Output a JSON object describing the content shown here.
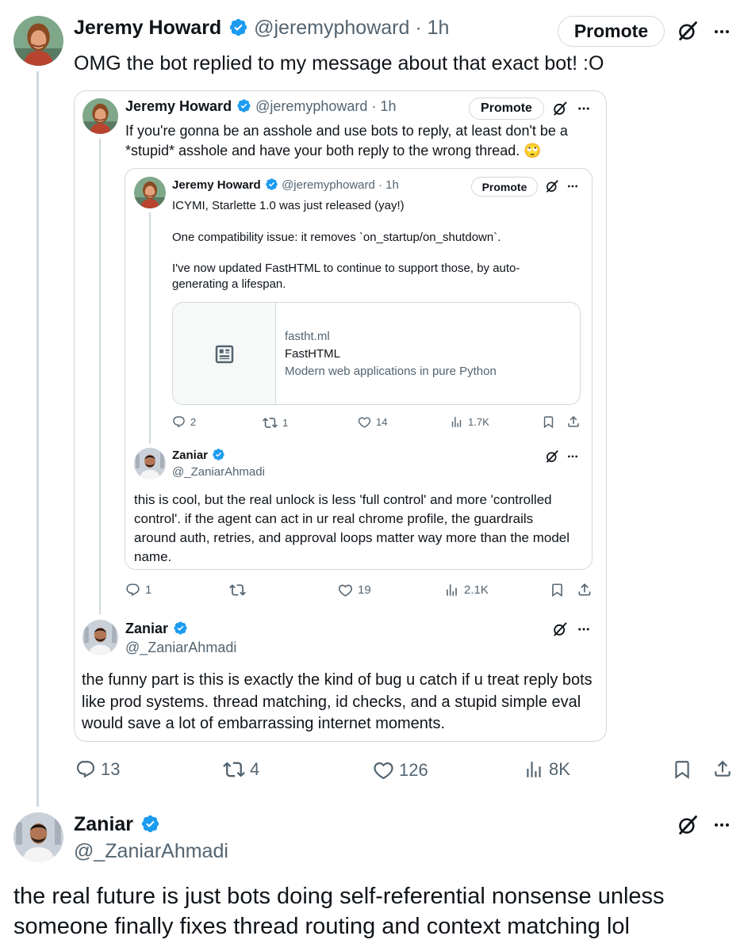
{
  "main": {
    "name": "Jeremy Howard",
    "handle": "@jeremyphoward",
    "time": "· 1h",
    "promote": "Promote",
    "text": "OMG the bot replied to my message about that exact bot! :O",
    "actions": {
      "reply": "13",
      "retweet": "4",
      "like": "126",
      "views": "8K"
    }
  },
  "quote1": {
    "name": "Jeremy Howard",
    "handle": "@jeremyphoward",
    "time": "· 1h",
    "promote": "Promote",
    "text": "If you're gonna be an asshole and use bots to reply, at least don't be a *stupid* asshole and have your both reply to the wrong thread. 🙄",
    "quote2": {
      "name": "Jeremy Howard",
      "handle": "@jeremyphoward",
      "time": "· 1h",
      "promote": "Promote",
      "para1": "ICYMI, Starlette 1.0 was just released (yay!)",
      "para2": "One compatibility issue: it removes `on_startup/on_shutdown`.",
      "para3": "I've now updated FastHTML to continue to support those, by auto-generating a lifespan.",
      "link": {
        "domain": "fastht.ml",
        "title": "FastHTML",
        "desc": "Modern web applications in pure Python"
      },
      "actions": {
        "reply": "2",
        "retweet": "1",
        "like": "14",
        "views": "1.7K"
      },
      "reply": {
        "name": "Zaniar",
        "handle": "@_ZaniarAhmadi",
        "text": "this is cool, but the real unlock is less 'full control' and more 'controlled control'. if the agent can act in ur real chrome profile, the guardrails around auth, retries, and approval loops matter way more than the model name."
      }
    },
    "actions": {
      "reply": "1",
      "retweet": "",
      "like": "19",
      "views": "2.1K"
    },
    "reply": {
      "name": "Zaniar",
      "handle": "@_ZaniarAhmadi",
      "text": "the funny part is this is exactly the kind of bug u catch if u treat reply bots like prod systems. thread matching, id checks, and a stupid simple eval would save a lot of embarrassing internet moments."
    }
  },
  "bottom": {
    "name": "Zaniar",
    "handle": "@_ZaniarAhmadi",
    "text": "the real future is just bots doing self-referential nonsense unless someone finally fixes thread routing and context matching lol"
  },
  "colors": {
    "accent": "#1d9bf0",
    "muted": "#536471",
    "border": "#cfd9de"
  }
}
